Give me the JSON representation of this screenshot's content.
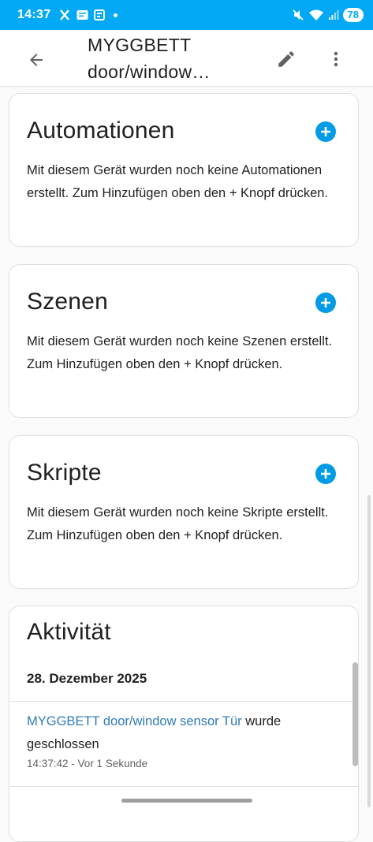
{
  "status_bar": {
    "time": "14:37",
    "battery": "78",
    "left_icons": [
      "x-icon",
      "news-icon",
      "square-icon"
    ],
    "right_icons": [
      "mute-icon",
      "wifi-icon",
      "signal-icon"
    ]
  },
  "header": {
    "title_line1": "MYGGBETT",
    "title_line2": "door/window…",
    "back_icon": "arrow-left-icon",
    "edit_icon": "pencil-icon",
    "more_icon": "more-vert-icon"
  },
  "cards": {
    "automations": {
      "title": "Automationen",
      "text": "Mit diesem Gerät wurden noch keine Automationen erstellt. Zum Hinzufügen oben den + Knopf drücken."
    },
    "scenes": {
      "title": "Szenen",
      "text": "Mit diesem Gerät wurden noch keine Szenen erstellt. Zum Hinzufügen oben den + Knopf drücken."
    },
    "scripts": {
      "title": "Skripte",
      "text": "Mit diesem Gerät wurden noch keine Skripte erstellt. Zum Hinzufügen oben den + Knopf drücken."
    },
    "activity": {
      "title": "Aktivität",
      "date": "28. Dezember 2025",
      "entry_entity": "MYGGBETT door/window sensor Tür",
      "entry_action": " wurde geschlossen",
      "entry_time": "14:37:42 - Vor 1 Sekunde"
    }
  },
  "colors": {
    "status_bar": "#03a9f4",
    "accent": "#039be5",
    "link": "#2f7bb7"
  }
}
